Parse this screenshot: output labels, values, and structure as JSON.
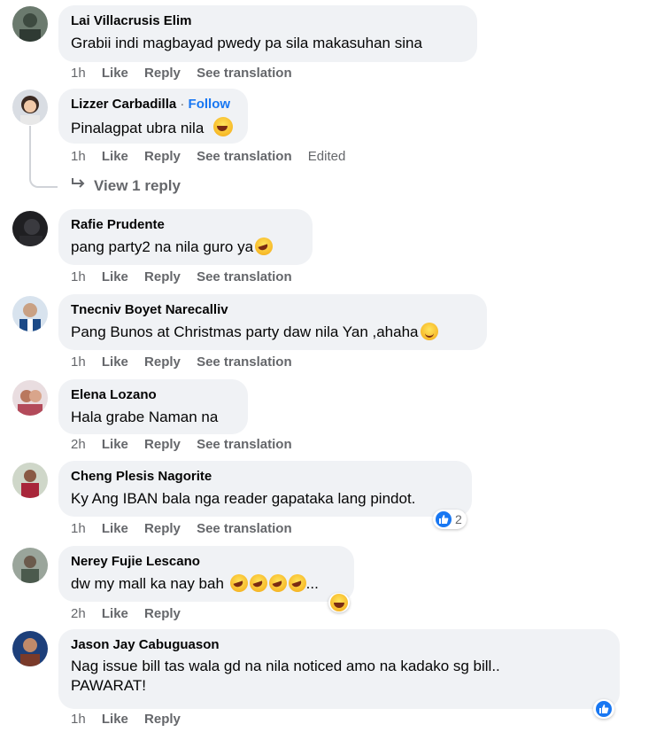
{
  "actions_labels": {
    "like": "Like",
    "reply": "Reply",
    "translate": "See translation"
  },
  "comments": [
    {
      "author": "Lai Villacrusis Elim",
      "text": "Grabii indi magbayad pwedy pa sila makasuhan sina",
      "time": "1h",
      "edited": ""
    },
    {
      "author": "Lizzer Carbadilla",
      "follow": "Follow",
      "sep": "·",
      "text": "Pinalagpat ubra nila",
      "time": "1h",
      "edited": "Edited"
    },
    {
      "author": "Rafie Prudente",
      "text": "pang party2 na nila guro ya",
      "time": "1h",
      "edited": ""
    },
    {
      "author": "Tnecniv Boyet Narecalliv",
      "text": "Pang Bunos at Christmas party daw nila Yan ,ahaha",
      "time": "1h",
      "edited": ""
    },
    {
      "author": "Elena Lozano",
      "text": "Hala grabe Naman na",
      "time": "2h",
      "edited": ""
    },
    {
      "author": "Cheng Plesis Nagorite",
      "text": "Ky Ang IBAN bala nga reader gapataka lang pindot.",
      "time": "1h",
      "edited": "",
      "reaction_count": "2"
    },
    {
      "author": "Nerey Fujie Lescano",
      "text": "dw my mall ka nay bah",
      "ellipsis": "...",
      "time": "2h",
      "edited": ""
    },
    {
      "author": "Jason Jay Cabuguason",
      "text_line1": "Nag issue bill tas wala gd na nila noticed amo na kadako sg bill..",
      "text_line2": "PAWARAT!",
      "time": "1h",
      "edited": ""
    }
  ],
  "view_reply": "View 1 reply",
  "colors": {
    "bubble": "#f0f2f5",
    "link": "#1877f2",
    "meta": "#65676b",
    "text": "#050505"
  }
}
